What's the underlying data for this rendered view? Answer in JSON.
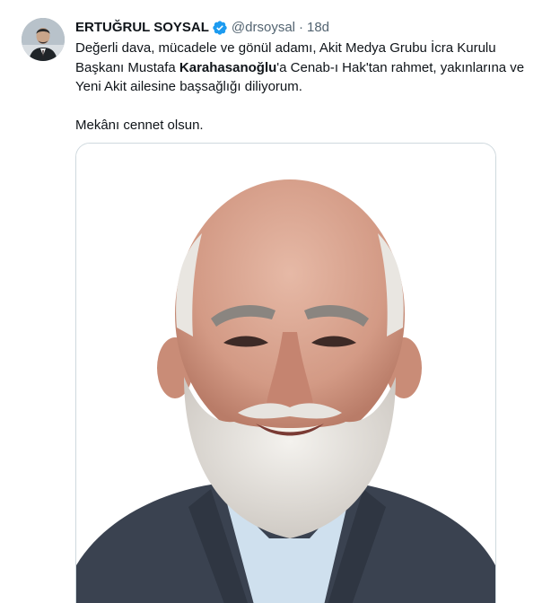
{
  "tweet": {
    "author": {
      "display_name": "ERTUĞRUL SOYSAL",
      "handle": "@drsoysal",
      "verified": true,
      "avatar_icon": "user-avatar"
    },
    "separator": "·",
    "timestamp": "18d",
    "text": {
      "line1": "Değerli dava, mücadele ve gönül adamı, Akit Medya Grubu İcra Kurulu",
      "line2_before": "Başkanı Mustafa ",
      "line2_bold": "Karahasanoğlu",
      "line2_after": "'a Cenab-ı Hak'tan rahmet, yakınlarına ve",
      "line3": "Yeni Akit ailesine başsağlığı diliyorum.",
      "line4": "Mekânı cennet olsun."
    },
    "media": {
      "type": "photo"
    }
  },
  "colors": {
    "text_primary": "#0f1419",
    "text_secondary": "#536471",
    "verified_blue": "#1d9bf0",
    "media_border": "#cfd9de"
  }
}
